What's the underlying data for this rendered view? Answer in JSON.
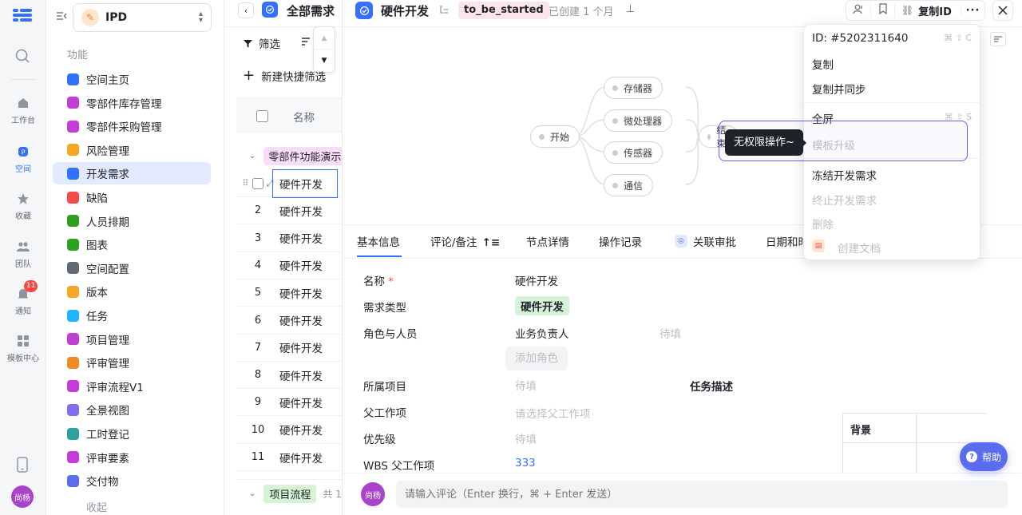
{
  "rail": {
    "items": [
      {
        "label": "工作台"
      },
      {
        "label": "空间"
      },
      {
        "label": "收藏"
      },
      {
        "label": "团队"
      },
      {
        "label": "通知",
        "badge": "11"
      },
      {
        "label": "模板中心"
      }
    ],
    "avatar": "尚杨"
  },
  "sidebar": {
    "project": "IPD",
    "section": "功能",
    "items": [
      {
        "label": "空间主页",
        "color": "#3370ff"
      },
      {
        "label": "零部件库存管理",
        "color": "#c13fd5"
      },
      {
        "label": "零部件采购管理",
        "color": "#c13fd5"
      },
      {
        "label": "风险管理",
        "color": "#f5a623"
      },
      {
        "label": "开发需求",
        "color": "#3370ff"
      },
      {
        "label": "缺陷",
        "color": "#f54a45"
      },
      {
        "label": "人员排期",
        "color": "#2ea121"
      },
      {
        "label": "图表",
        "color": "#2ea121"
      },
      {
        "label": "空间配置",
        "color": "#646a73"
      },
      {
        "label": "版本",
        "color": "#f5a623"
      },
      {
        "label": "任务",
        "color": "#1fb6ff"
      },
      {
        "label": "项目管理",
        "color": "#c13fd5"
      },
      {
        "label": "评审管理",
        "color": "#f08a24"
      },
      {
        "label": "评审流程V1",
        "color": "#c13fd5"
      },
      {
        "label": "全景视图",
        "color": "#7f6ff0"
      },
      {
        "label": "工时登记",
        "color": "#2ea1a1"
      },
      {
        "label": "评审要素",
        "color": "#c13fd5"
      },
      {
        "label": "交付物",
        "color": "#5b6cf0"
      }
    ],
    "collapse": "收起"
  },
  "list": {
    "title": "全部需求",
    "filter": "筛选",
    "new_filter": "新建快捷筛选",
    "col_name": "名称",
    "group1": "零部件功能演示",
    "rows": [
      {
        "num": "",
        "name": "硬件开发"
      },
      {
        "num": "2",
        "name": "硬件开发"
      },
      {
        "num": "3",
        "name": "硬件开发"
      },
      {
        "num": "4",
        "name": "硬件开发"
      },
      {
        "num": "5",
        "name": "硬件开发"
      },
      {
        "num": "6",
        "name": "硬件开发"
      },
      {
        "num": "7",
        "name": "硬件开发"
      },
      {
        "num": "8",
        "name": "硬件开发"
      },
      {
        "num": "9",
        "name": "硬件开发"
      },
      {
        "num": "10",
        "name": "硬件开发"
      },
      {
        "num": "11",
        "name": "硬件开发"
      }
    ],
    "group2": "项目流程",
    "group2_count": "共 1"
  },
  "detail": {
    "title": "硬件开发",
    "status": "to_be_started",
    "created": "已创建 1 个月",
    "copy_id": "复制ID",
    "flow_nodes": [
      "开始",
      "存储器",
      "微处理器",
      "传感器",
      "通信",
      "结束"
    ],
    "tooltip": "无权限操作~",
    "tabs": [
      "基本信息",
      "评论/备注",
      "节点详情",
      "操作记录",
      "关联审批",
      "日期和时"
    ],
    "fields": {
      "name_label": "名称",
      "name_value": "硬件开发",
      "type_label": "需求类型",
      "type_value": "硬件开发",
      "role_label": "角色与人员",
      "role_name": "业务负责人",
      "role_value": "待填",
      "add_role": "添加角色",
      "project_label": "所属项目",
      "project_value": "待填",
      "task_desc": "任务描述",
      "parent_label": "父工作项",
      "parent_value": "请选择父工作项",
      "priority_label": "优先级",
      "priority_value": "待填",
      "wbs_label": "WBS 父工作项",
      "wbs_value": "333",
      "table_header": "背景"
    },
    "comment_avatar": "尚杨",
    "comment_placeholder": "请输入评论（Enter 换行，⌘ + Enter 发送）",
    "help": "帮助"
  },
  "menu": {
    "id_label": "ID: #5202311640",
    "id_shortcut": "⌘ ⇧ C",
    "copy": "复制",
    "copy_sync": "复制并同步",
    "fullscreen": "全屏",
    "fullscreen_shortcut": "⌘ ⇧ S",
    "template_upgrade": "模板升级",
    "freeze": "冻结开发需求",
    "terminate": "终止开发需求",
    "delete": "删除",
    "create_doc": "创建文档"
  }
}
